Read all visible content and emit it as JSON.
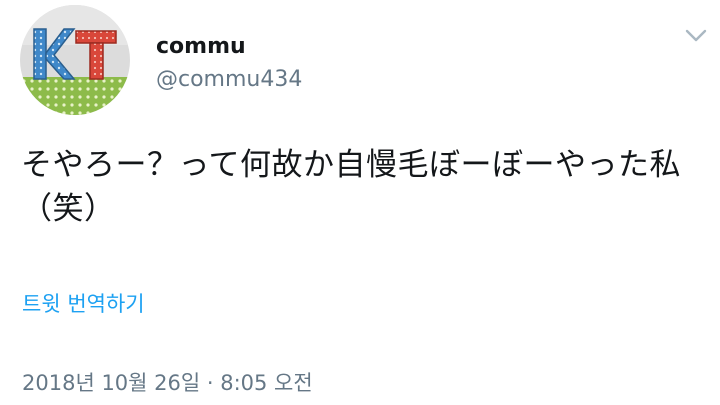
{
  "user": {
    "display_name": "commu",
    "handle": "@commu434",
    "avatar_letters": "KT"
  },
  "tweet": {
    "text": "そやろー？って何故か自慢毛ぼーぼーやった私（笑）",
    "translate_label": "트윗 번역하기",
    "timestamp": "2018년 10월 26일 · 8:05 오전"
  },
  "icons": {
    "more": "chevron-down-icon"
  },
  "colors": {
    "text": "#14171a",
    "secondary": "#657786",
    "link": "#1da1f2"
  }
}
